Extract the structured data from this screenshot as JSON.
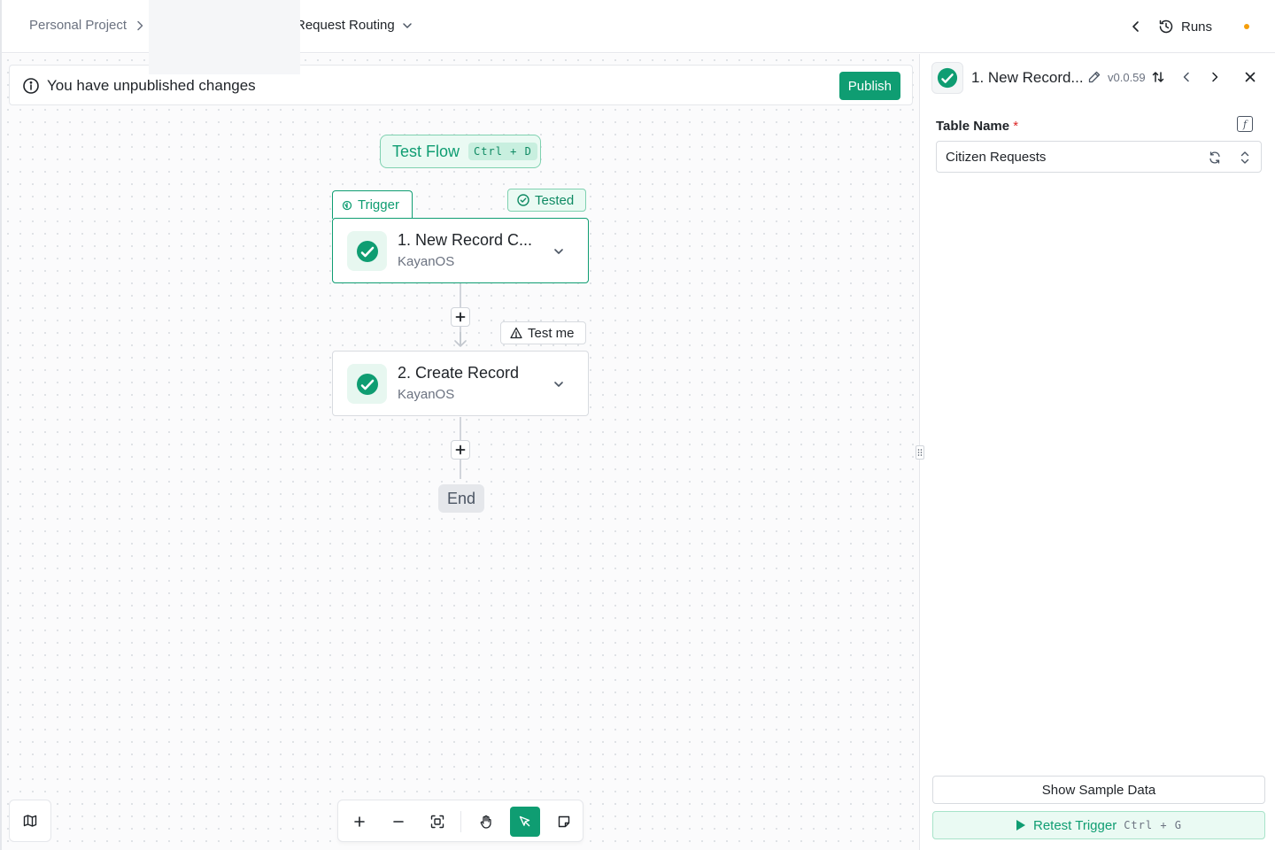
{
  "header": {
    "breadcrumb_project": "Personal Project",
    "flow_name": "Request Routing",
    "runs_label": "Runs",
    "status_dot_color": "#f59e0b"
  },
  "banner": {
    "message": "You have unpublished changes",
    "publish_label": "Publish"
  },
  "test_flow": {
    "label": "Test Flow",
    "shortcut": "Ctrl + D"
  },
  "trigger_step": {
    "tab_label": "Trigger",
    "badge": "Tested",
    "title": "1. New Record C...",
    "app": "KayanOS"
  },
  "action_step": {
    "badge": "Test me",
    "title": "2. Create Record",
    "app": "KayanOS"
  },
  "end_label": "End",
  "toolbar": {
    "icons": [
      "map-icon",
      "zoom-in-icon",
      "zoom-out-icon",
      "fit-view-icon",
      "hand-icon",
      "pointer-icon",
      "note-icon"
    ]
  },
  "panel": {
    "title": "1. New Record...",
    "version": "v0.0.59",
    "field_label": "Table Name",
    "required_mark": "*",
    "field_value": "Citizen Requests",
    "show_sample_label": "Show Sample Data",
    "retest_label": "Retest Trigger",
    "retest_shortcut": "Ctrl + G"
  },
  "colors": {
    "accent": "#0f9d72",
    "accent_light": "#eafaf3"
  }
}
